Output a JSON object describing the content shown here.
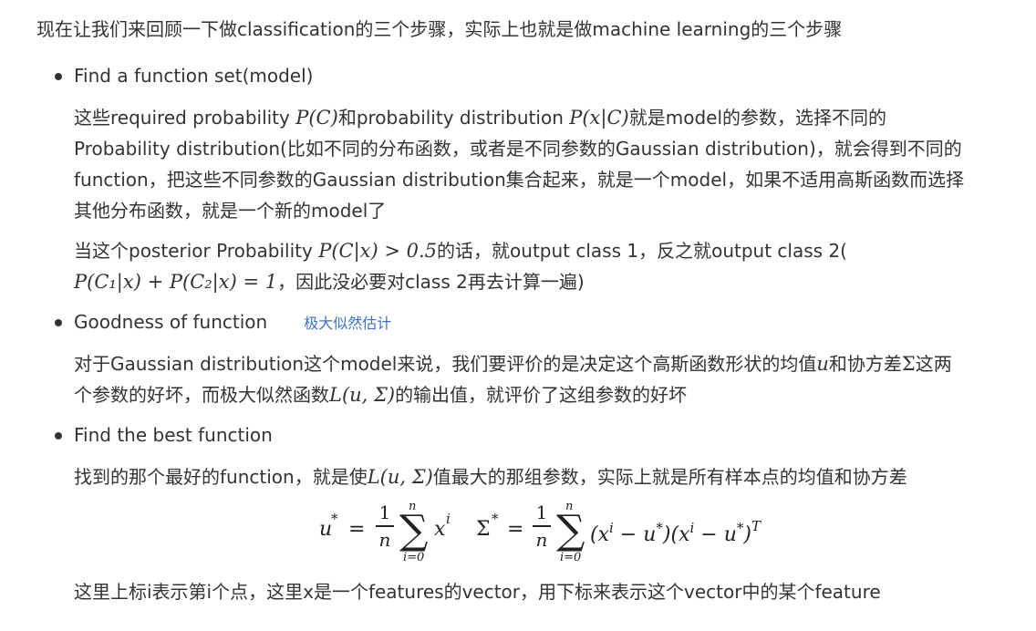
{
  "intro": "现在让我们来回顾一下做classification的三个步骤，实际上也就是做machine learning的三个步骤",
  "step1": {
    "title": "Find a function set(model)",
    "p1_l1_a": "这些required probability ",
    "p1_l1_m1": "P(C)",
    "p1_l1_b": "和probability distribution ",
    "p1_l1_m2": "P(x|C)",
    "p1_l1_c": "就是model的参数，选择不同的",
    "p1_l2": "Probability distribution(比如不同的分布函数，或者是不同参数的Gaussian distribution)，就会得到不同的",
    "p1_l3": "function，把这些不同参数的Gaussian distribution集合起来，就是一个model，如果不适用高斯函数而选择",
    "p1_l4": "其他分布函数，就是一个新的model了",
    "p2_l1_a": "当这个posterior Probability ",
    "p2_l1_m": "P(C|x) > 0.5",
    "p2_l1_b": "的话，就output class 1，反之就output class 2(",
    "p2_l2_m": "P(C₁|x) + P(C₂|x) = 1",
    "p2_l2_b": "，因此没必要对class 2再去计算一遍)"
  },
  "step2": {
    "title": "Goodness of function",
    "link": "极大似然估计",
    "p_l1_a": "对于Gaussian distribution这个model来说，我们要评价的是决定这个高斯函数形状的均值",
    "p_l1_m1": "u",
    "p_l1_b": "和协方差",
    "p_l1_m2": "Σ",
    "p_l1_c": "这两",
    "p_l2_a": "个参数的好坏，而极大似然函数",
    "p_l2_m": "L(u, Σ)",
    "p_l2_b": "的输出值，就评价了这组参数的好坏"
  },
  "step3": {
    "title": "Find the best function",
    "p_a": "找到的那个最好的function，就是使",
    "p_m": "L(u, Σ)",
    "p_b": "值最大的那组参数，实际上就是所有样本点的均值和协方差",
    "formula": {
      "lhs1": "u",
      "star": "*",
      "eq": "=",
      "one": "1",
      "n": "n",
      "sum_top": "n",
      "sum_bot": "i=0",
      "term1": "x",
      "sup_i": "i",
      "lhs2": "Σ",
      "term2_a": "(x",
      "term2_b": " − u",
      "term2_c": ")(x",
      "term2_d": " − u",
      "term2_e": ")",
      "sup_T": "T"
    },
    "footer": "这里上标i表示第i个点，这里x是一个features的vector，用下标来表示这个vector中的某个feature"
  }
}
